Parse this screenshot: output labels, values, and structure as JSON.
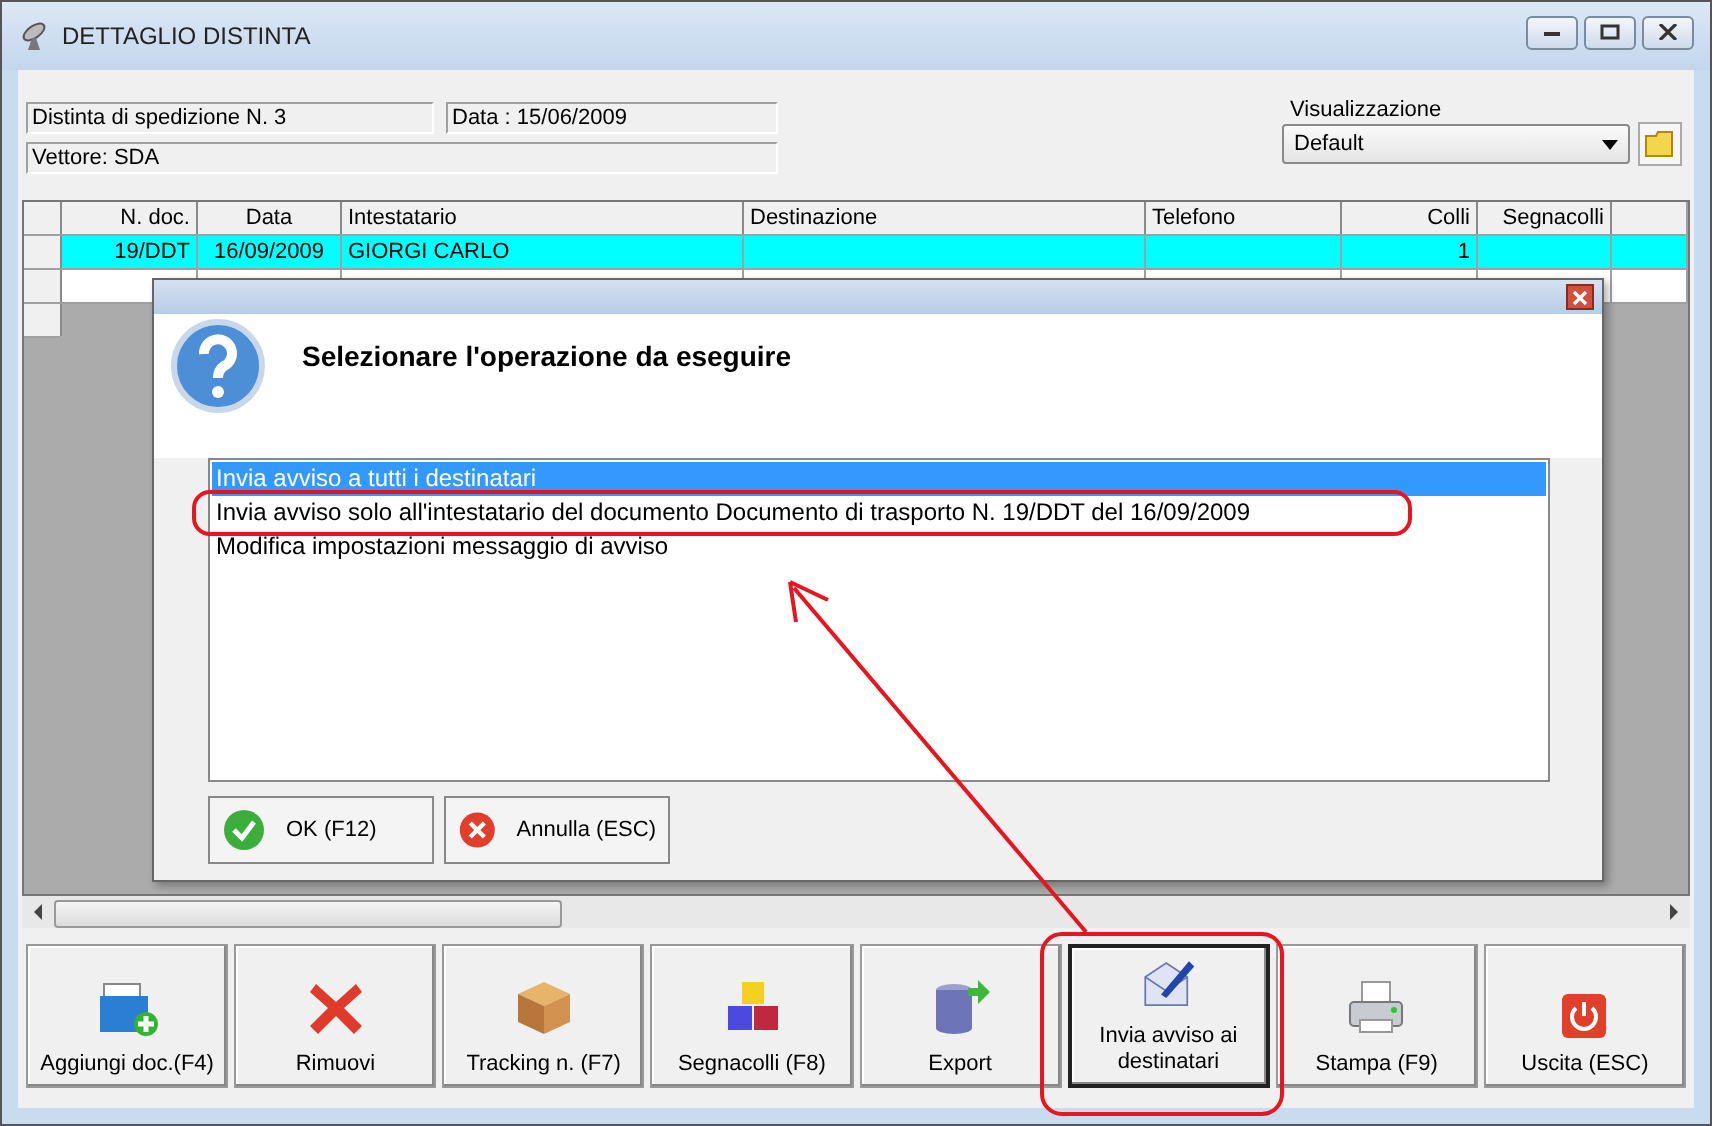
{
  "window": {
    "title": "DETTAGLIO DISTINTA"
  },
  "info": {
    "distinta": "Distinta di spedizione N. 3",
    "data": "Data : 15/06/2009",
    "vettore": "Vettore: SDA"
  },
  "view": {
    "label": "Visualizzazione",
    "value": "Default"
  },
  "table": {
    "columns": [
      {
        "label": "N. doc."
      },
      {
        "label": "Data"
      },
      {
        "label": "Intestatario"
      },
      {
        "label": "Destinazione"
      },
      {
        "label": "Telefono"
      },
      {
        "label": "Colli"
      },
      {
        "label": "Segnacolli"
      }
    ],
    "rows": [
      {
        "selected": true,
        "cells": [
          "19/DDT",
          "16/09/2009",
          "GIORGI CARLO",
          "",
          "",
          "1",
          ""
        ]
      },
      {
        "selected": false
      }
    ]
  },
  "toolbar": [
    {
      "label": "Aggiungi doc.(F4)",
      "kind": "add",
      "focused": false
    },
    {
      "label": "Rimuovi",
      "kind": "remove",
      "focused": false
    },
    {
      "label": "Tracking n. (F7)",
      "kind": "tracking",
      "focused": false
    },
    {
      "label": "Segnacolli (F8)",
      "kind": "labels",
      "focused": false
    },
    {
      "label": "Export",
      "kind": "export",
      "focused": false
    },
    {
      "label": "Invia avviso ai destinatari",
      "kind": "mail",
      "focused": true
    },
    {
      "label": "Stampa (F9)",
      "kind": "print",
      "focused": false
    },
    {
      "label": "Uscita (ESC)",
      "kind": "exit",
      "focused": false
    }
  ],
  "dialog": {
    "heading": "Selezionare l'operazione da eseguire",
    "options": [
      {
        "label": "Invia avviso a tutti i destinatari",
        "selected": true
      },
      {
        "label": "Invia avviso solo all'intestatario del documento Documento di trasporto N. 19/DDT del 16/09/2009",
        "selected": false
      },
      {
        "label": "Modifica impostazioni messaggio di avviso",
        "selected": false
      }
    ],
    "buttons": [
      {
        "label": "OK (F12)",
        "kind": "ok"
      },
      {
        "label": "Annulla (ESC)",
        "kind": "cancel"
      }
    ]
  }
}
